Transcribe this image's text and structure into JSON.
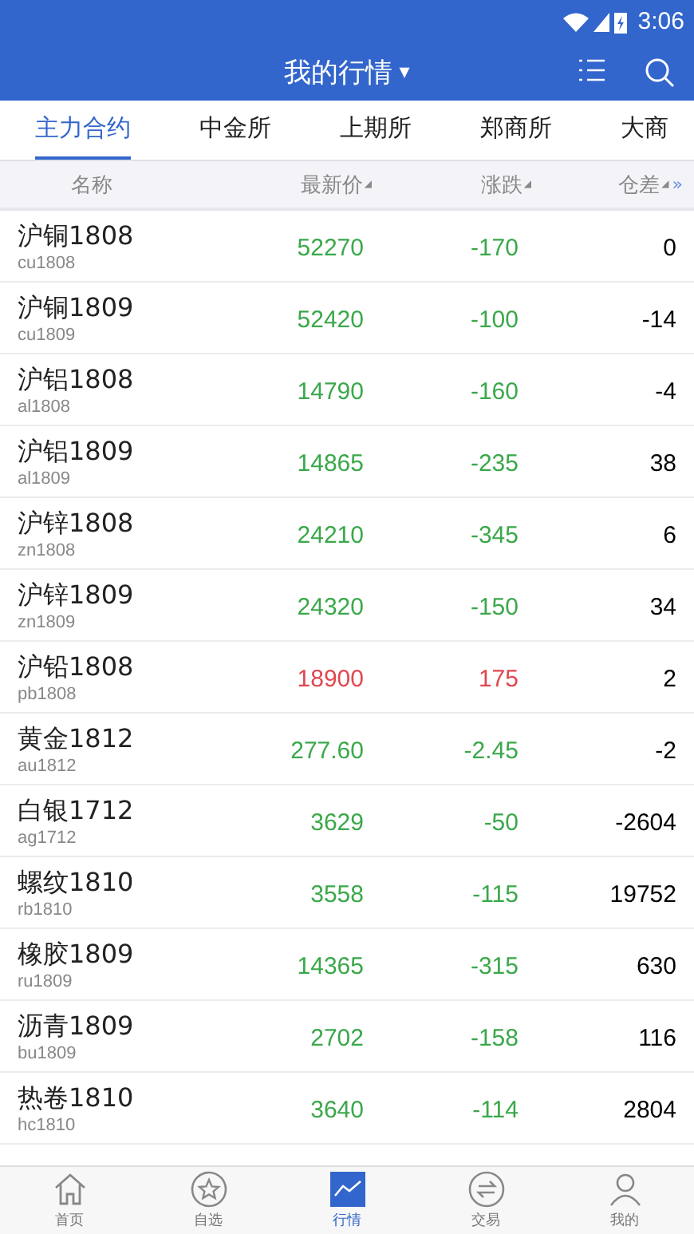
{
  "status_bar": {
    "time": "3:06"
  },
  "header": {
    "title": "我的行情",
    "dropdown": "▾"
  },
  "tabs": [
    {
      "label": "主力合约",
      "selected": true
    },
    {
      "label": "中金所",
      "selected": false
    },
    {
      "label": "上期所",
      "selected": false
    },
    {
      "label": "郑商所",
      "selected": false
    },
    {
      "label": "大商",
      "selected": false
    }
  ],
  "table": {
    "columns": [
      "名称",
      "最新价",
      "涨跌",
      "仓差"
    ],
    "sort_mark": "◢",
    "more": "»",
    "rows": [
      {
        "name": "沪铜1808",
        "code": "cu1808",
        "price": "52270",
        "change": "-170",
        "oi_change": "0",
        "kind": "down"
      },
      {
        "name": "沪铜1809",
        "code": "cu1809",
        "price": "52420",
        "change": "-100",
        "oi_change": "-14",
        "kind": "down"
      },
      {
        "name": "沪铝1808",
        "code": "al1808",
        "price": "14790",
        "change": "-160",
        "oi_change": "-4",
        "kind": "down"
      },
      {
        "name": "沪铝1809",
        "code": "al1809",
        "price": "14865",
        "change": "-235",
        "oi_change": "38",
        "kind": "down"
      },
      {
        "name": "沪锌1808",
        "code": "zn1808",
        "price": "24210",
        "change": "-345",
        "oi_change": "6",
        "kind": "down"
      },
      {
        "name": "沪锌1809",
        "code": "zn1809",
        "price": "24320",
        "change": "-150",
        "oi_change": "34",
        "kind": "down"
      },
      {
        "name": "沪铅1808",
        "code": "pb1808",
        "price": "18900",
        "change": "175",
        "oi_change": "2",
        "kind": "up"
      },
      {
        "name": "黄金1812",
        "code": "au1812",
        "price": "277.60",
        "change": "-2.45",
        "oi_change": "-2",
        "kind": "down"
      },
      {
        "name": "白银1712",
        "code": "ag1712",
        "price": "3629",
        "change": "-50",
        "oi_change": "-2604",
        "kind": "down"
      },
      {
        "name": "螺纹1810",
        "code": "rb1810",
        "price": "3558",
        "change": "-115",
        "oi_change": "19752",
        "kind": "down"
      },
      {
        "name": "橡胶1809",
        "code": "ru1809",
        "price": "14365",
        "change": "-315",
        "oi_change": "630",
        "kind": "down"
      },
      {
        "name": "沥青1809",
        "code": "bu1809",
        "price": "2702",
        "change": "-158",
        "oi_change": "116",
        "kind": "down"
      },
      {
        "name": "热卷1810",
        "code": "hc1810",
        "price": "3640",
        "change": "-114",
        "oi_change": "2804",
        "kind": "down"
      }
    ]
  },
  "nav": [
    {
      "label": "首页",
      "kind": "home",
      "selected": false
    },
    {
      "label": "自选",
      "kind": "star",
      "selected": false
    },
    {
      "label": "行情",
      "kind": "chart",
      "selected": true
    },
    {
      "label": "交易",
      "kind": "trade",
      "selected": false
    },
    {
      "label": "我的",
      "kind": "user",
      "selected": false
    }
  ]
}
